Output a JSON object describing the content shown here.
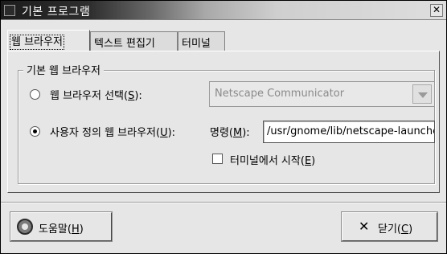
{
  "window": {
    "title": "기본 프로그램",
    "close_glyph": "✕"
  },
  "tabs": [
    {
      "label": "웹 브라우저",
      "active": true
    },
    {
      "label": "텍스트 편집기",
      "active": false
    },
    {
      "label": "터미널",
      "active": false
    }
  ],
  "group": {
    "title": "기본 웹 브라우저"
  },
  "option_select": {
    "label": "웹 브라우저 선택",
    "mnemonic": "S",
    "selected": false,
    "combo_value": "Netscape Communicator"
  },
  "option_custom": {
    "label": "사용자 정의 웹 브라우저",
    "mnemonic": "U",
    "selected": true
  },
  "command": {
    "label": "명령",
    "mnemonic": "M",
    "value": "/usr/gnome/lib/netscape-launcher"
  },
  "terminal_check": {
    "label": "터미널에서 시작",
    "mnemonic": "E",
    "checked": false
  },
  "buttons": {
    "help": {
      "label": "도움말",
      "mnemonic": "H",
      "icon": "help-lifebuoy-icon"
    },
    "close": {
      "label": "닫기",
      "mnemonic": "C",
      "icon": "close-x-icon"
    }
  }
}
